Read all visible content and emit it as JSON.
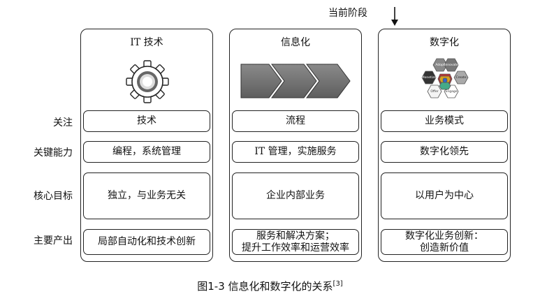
{
  "marker": {
    "label": "当前阶段",
    "arrow_icon": "down-arrow-icon"
  },
  "rows": {
    "focus": "关注",
    "capability": "关键能力",
    "goal": "核心目标",
    "output": "主要产出"
  },
  "panels": [
    {
      "title": "IT 技术",
      "icon": "gear-icon",
      "focus": "技术",
      "capability": "编程，系统管理",
      "goal": "独立，与业务无关",
      "output": "局部自动化和技术创新"
    },
    {
      "title": "信息化",
      "icon": "chevron-process-icon",
      "focus": "流程",
      "capability": "IT 管理，实施服务",
      "goal": "企业内部业务",
      "output_line1": "服务和解决方案；",
      "output_line2": "提升工作效率和运营效率"
    },
    {
      "title": "数字化",
      "icon": "hexagon-cycle-icon",
      "focus": "业务模式",
      "capability": "数字化领先",
      "goal": "以用户为中心",
      "output_line1": "数字化业务创新：",
      "output_line2": "创造新价值",
      "hex_labels": [
        "Adopt",
        "Innovate",
        "Monetize",
        "Create",
        "Offer",
        "Engage"
      ]
    }
  ],
  "caption": {
    "text": "图1-3  信息化和数字化的关系",
    "ref": "[3]"
  }
}
